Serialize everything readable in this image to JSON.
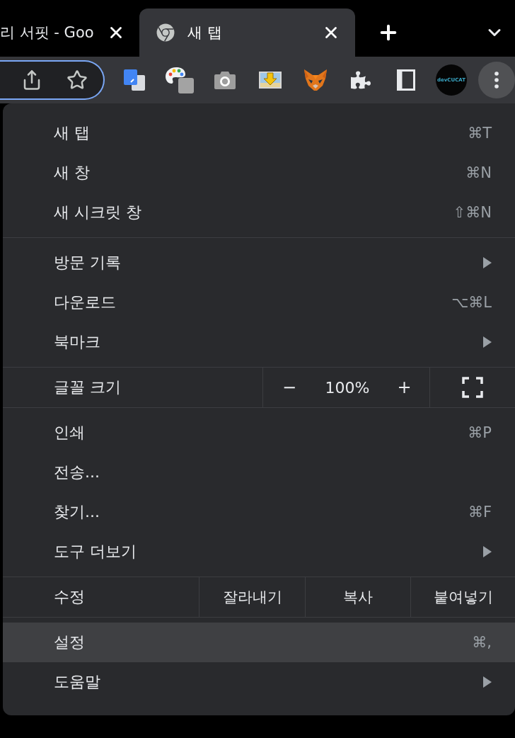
{
  "tabs": [
    {
      "title": "리 서핏 - Goo",
      "selected": false
    },
    {
      "title": "새 탭",
      "selected": true
    }
  ],
  "toolbar": {
    "profile_label": "devCUCAT"
  },
  "menu": {
    "sections": [
      {
        "kind": "list",
        "items": [
          {
            "label": "새 탭",
            "shortcut": "⌘T",
            "submenu": false,
            "highlighted": false
          },
          {
            "label": "새 창",
            "shortcut": "⌘N",
            "submenu": false,
            "highlighted": false
          },
          {
            "label": "새 시크릿 창",
            "shortcut": "⇧⌘N",
            "submenu": false,
            "highlighted": false
          }
        ]
      },
      {
        "kind": "list",
        "items": [
          {
            "label": "방문 기록",
            "submenu": true,
            "highlighted": false
          },
          {
            "label": "다운로드",
            "shortcut": "⌥⌘L",
            "submenu": false,
            "highlighted": false
          },
          {
            "label": "북마크",
            "submenu": true,
            "highlighted": false
          }
        ]
      },
      {
        "kind": "zoom",
        "label": "글꼴 크기",
        "decrease": "−",
        "value": "100%",
        "increase": "+"
      },
      {
        "kind": "list",
        "items": [
          {
            "label": "인쇄",
            "shortcut": "⌘P",
            "submenu": false,
            "highlighted": false
          },
          {
            "label": "전송...",
            "submenu": false,
            "highlighted": false
          },
          {
            "label": "찾기...",
            "shortcut": "⌘F",
            "submenu": false,
            "highlighted": false
          },
          {
            "label": "도구 더보기",
            "submenu": true,
            "highlighted": false
          }
        ]
      },
      {
        "kind": "edit",
        "label": "수정",
        "actions": [
          "잘라내기",
          "복사",
          "붙여넣기"
        ]
      },
      {
        "kind": "list",
        "items": [
          {
            "label": "설정",
            "shortcut": "⌘,",
            "submenu": false,
            "highlighted": true
          },
          {
            "label": "도움말",
            "submenu": true,
            "highlighted": false
          }
        ]
      }
    ]
  }
}
